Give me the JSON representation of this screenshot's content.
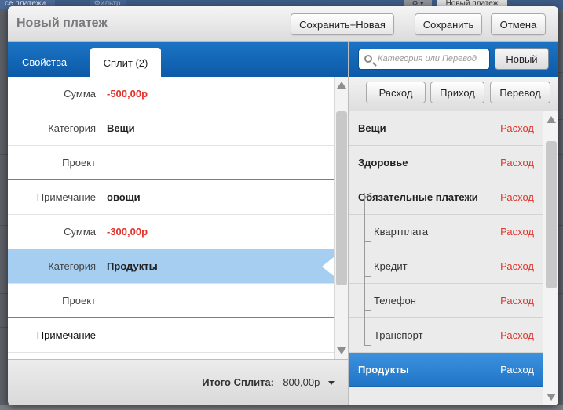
{
  "background": {
    "tab_label": "се платежи",
    "tab2_label": "Фильтр",
    "right_button": "Новый платеж"
  },
  "dialog": {
    "title": "Новый платеж",
    "buttons": {
      "save_new": "Сохранить+Новая",
      "save": "Сохранить",
      "cancel": "Отмена"
    }
  },
  "tabs": {
    "properties": "Свойства",
    "split": "Сплит (2)"
  },
  "split_rows": [
    {
      "label": "Сумма",
      "value": "-500,00р",
      "negative": true
    },
    {
      "label": "Категория",
      "value": "Вещи"
    },
    {
      "label": "Проект",
      "value": ""
    },
    {
      "label": "Примечание",
      "value": "овощи"
    },
    {
      "label": "Сумма",
      "value": "-300,00р",
      "negative": true
    },
    {
      "label": "Категория",
      "value": "Продукты"
    },
    {
      "label": "Проект",
      "value": ""
    },
    {
      "label": "Примечание",
      "value": ""
    }
  ],
  "total": {
    "label": "Итого Сплита:",
    "value": "-800,00р"
  },
  "search": {
    "placeholder": "Категория или Перевод",
    "new_button": "Новый"
  },
  "type_buttons": {
    "expense": "Расход",
    "income": "Приход",
    "transfer": "Перевод"
  },
  "categories": [
    {
      "name": "Вещи",
      "type": "Расход",
      "bold": true
    },
    {
      "name": "Здоровье",
      "type": "Расход",
      "bold": true
    },
    {
      "name": "Обязательные платежи",
      "type": "Расход",
      "bold": true
    },
    {
      "name": "Квартплата",
      "type": "Расход",
      "child": true
    },
    {
      "name": "Кредит",
      "type": "Расход",
      "child": true
    },
    {
      "name": "Телефон",
      "type": "Расход",
      "child": true
    },
    {
      "name": "Транспорт",
      "type": "Расход",
      "child": true
    },
    {
      "name": "Продукты",
      "type": "Расход",
      "bold": true,
      "selected": true
    }
  ],
  "colors": {
    "accent_blue": "#1466b5",
    "negative_red": "#e0342d",
    "selected_row": "#a6cef0"
  }
}
